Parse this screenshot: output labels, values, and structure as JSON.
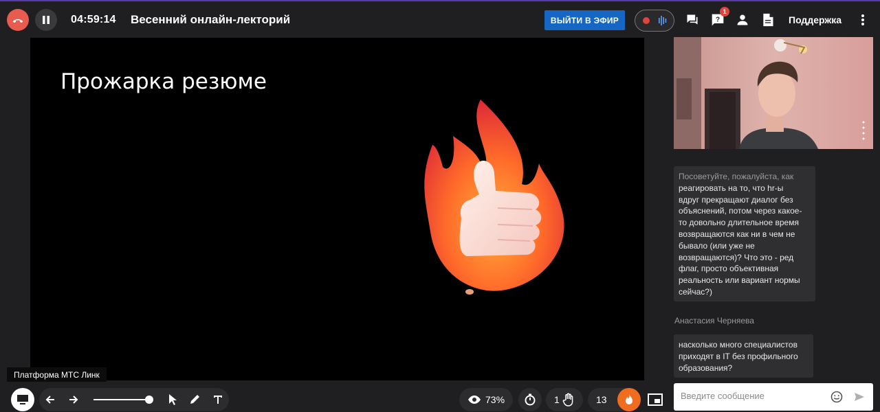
{
  "header": {
    "timer": "04:59:14",
    "event_title": "Весенний онлайн-лекторий",
    "go_live_label": "ВЫЙТИ В ЭФИР",
    "questions_badge": "1",
    "support_label": "Поддержка"
  },
  "slide": {
    "title": "Прожарка резюме",
    "watermark": "Платформа МТС Линк"
  },
  "toolbar": {
    "viewers_percent": "73%",
    "raised_hands": "1",
    "reactions_count": "13"
  },
  "chat": {
    "messages": [
      {
        "lines": [
          "Посоветуйте, пожалуйста, как",
          "реагировать на то, что hr-ы",
          "вдруг прекращают диалог без",
          "объяснений, потом через какое-",
          "то довольно длительное время",
          "возвращаются как ни в чем не",
          "бывало (или уже не",
          "возвращаются)? Что это - ред",
          "флаг, просто объективная",
          "реальность или вариант нормы",
          "сейчас?)"
        ]
      },
      {
        "author": "Анастасия Черняева",
        "lines": [
          "насколько много специалистов",
          "приходят в IT без профильного",
          "образования?"
        ]
      }
    ],
    "input_placeholder": "Введите сообщение"
  },
  "icons": {
    "end_call": "phone-hangup-icon",
    "pause": "pause-icon",
    "record": "record-icon",
    "audio": "audio-bars-icon",
    "chat": "chat-icon",
    "questions": "question-icon",
    "participants": "person-icon",
    "files": "file-icon",
    "more": "kebab-icon",
    "screen": "monitor-icon",
    "prev": "arrow-left-icon",
    "next": "arrow-right-icon",
    "pointer": "cursor-icon",
    "pen": "pen-icon",
    "text": "text-icon",
    "views": "eye-icon",
    "stopwatch": "stopwatch-icon",
    "hand": "hand-icon",
    "fire": "fire-icon",
    "pip": "picture-in-picture-icon",
    "emoji": "smiley-icon",
    "send": "send-icon"
  },
  "colors": {
    "end_call": "#e85b4f",
    "go_live": "#1667c3",
    "fire": "#f06c1f",
    "record": "#e0443e"
  }
}
